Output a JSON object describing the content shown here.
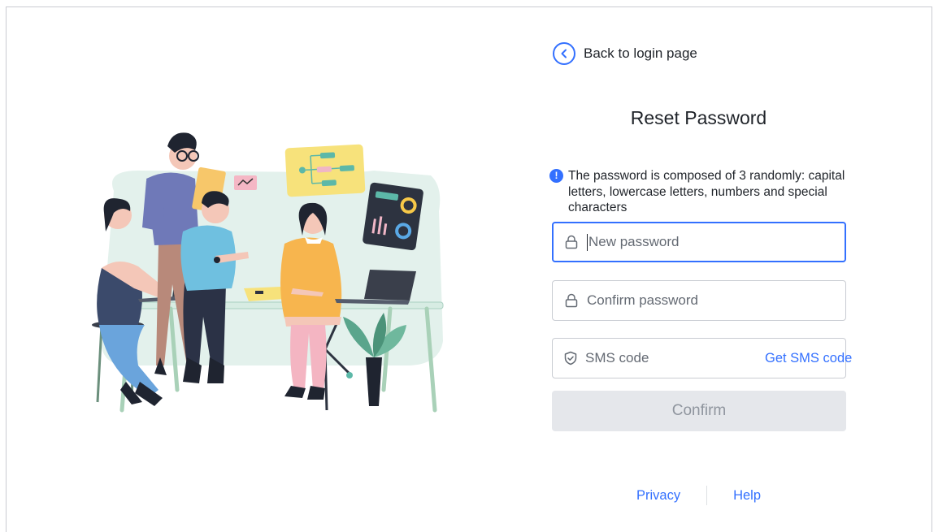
{
  "back": {
    "label": "Back to login page",
    "icon": "chevron-left-icon"
  },
  "title": "Reset Password",
  "notice": {
    "icon": "info-icon",
    "text": "The password is composed  of 3 randomly: capital letters, lowercase letters, numbers and special characters"
  },
  "fields": {
    "new_password": {
      "placeholder": "New password",
      "icon": "lock-icon"
    },
    "confirm_password": {
      "placeholder": "Confirm password",
      "icon": "lock-icon"
    },
    "sms_code": {
      "placeholder": "SMS code",
      "icon": "shield-check-icon",
      "action_label": "Get SMS code"
    }
  },
  "confirm_label": "Confirm",
  "footer": {
    "privacy": "Privacy",
    "help": "Help"
  },
  "colors": {
    "accent": "#3370ff",
    "disabled_bg": "#e5e7eb",
    "disabled_text": "#8f959e",
    "border": "#c9ccd2"
  }
}
